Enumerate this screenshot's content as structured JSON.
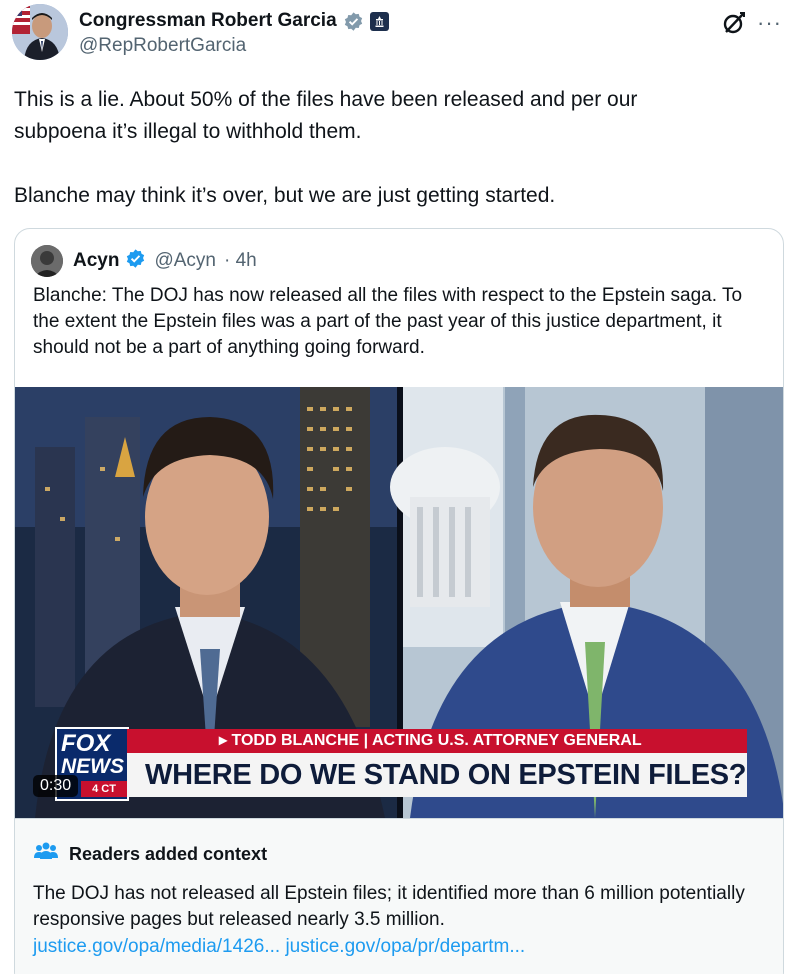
{
  "author": {
    "display_name": "Congressman Robert Garcia",
    "handle": "@RepRobertGarcia"
  },
  "tweet": {
    "lines": [
      "This is a lie. About 50% of the files have been released and per our",
      "subpoena it’s illegal to withhold them.",
      "Blanche may think it’s over, but we are just getting started."
    ]
  },
  "quote": {
    "display_name": "Acyn",
    "handle": "@Acyn",
    "time": "· 4h",
    "text": "Blanche: The DOJ has now released all the files with respect to the Epstein saga. To the extent the Epstein files was a part of the past year of this justice department, it should not be a part of anything going forward."
  },
  "video": {
    "duration": "0:30",
    "chyron_top": "▸ TODD BLANCHE | ACTING U.S. ATTORNEY GENERAL",
    "chyron_main": "WHERE DO WE STAND ON EPSTEIN FILES?",
    "logo_fox": "FOX",
    "logo_news": "NEWS",
    "logo_ct": "4 CT"
  },
  "context": {
    "title": "Readers added context",
    "text": "The DOJ has not released all Epstein files; it identified more than 6 million potentially responsive pages but released nearly 3.5 million.",
    "link1": "justice.gov/opa/media/1426...",
    "link2": "justice.gov/opa/pr/departm..."
  },
  "colors": {
    "accent": "#1d9bf0",
    "text": "#0f1419",
    "muted": "#536471",
    "verified_gray": "#829aab",
    "chyron_red": "#c8102e"
  },
  "icons": [
    "gray-verified-icon",
    "government-badge-icon",
    "grok-icon",
    "more-options-icon",
    "blue-verified-icon",
    "readers-context-icon"
  ]
}
